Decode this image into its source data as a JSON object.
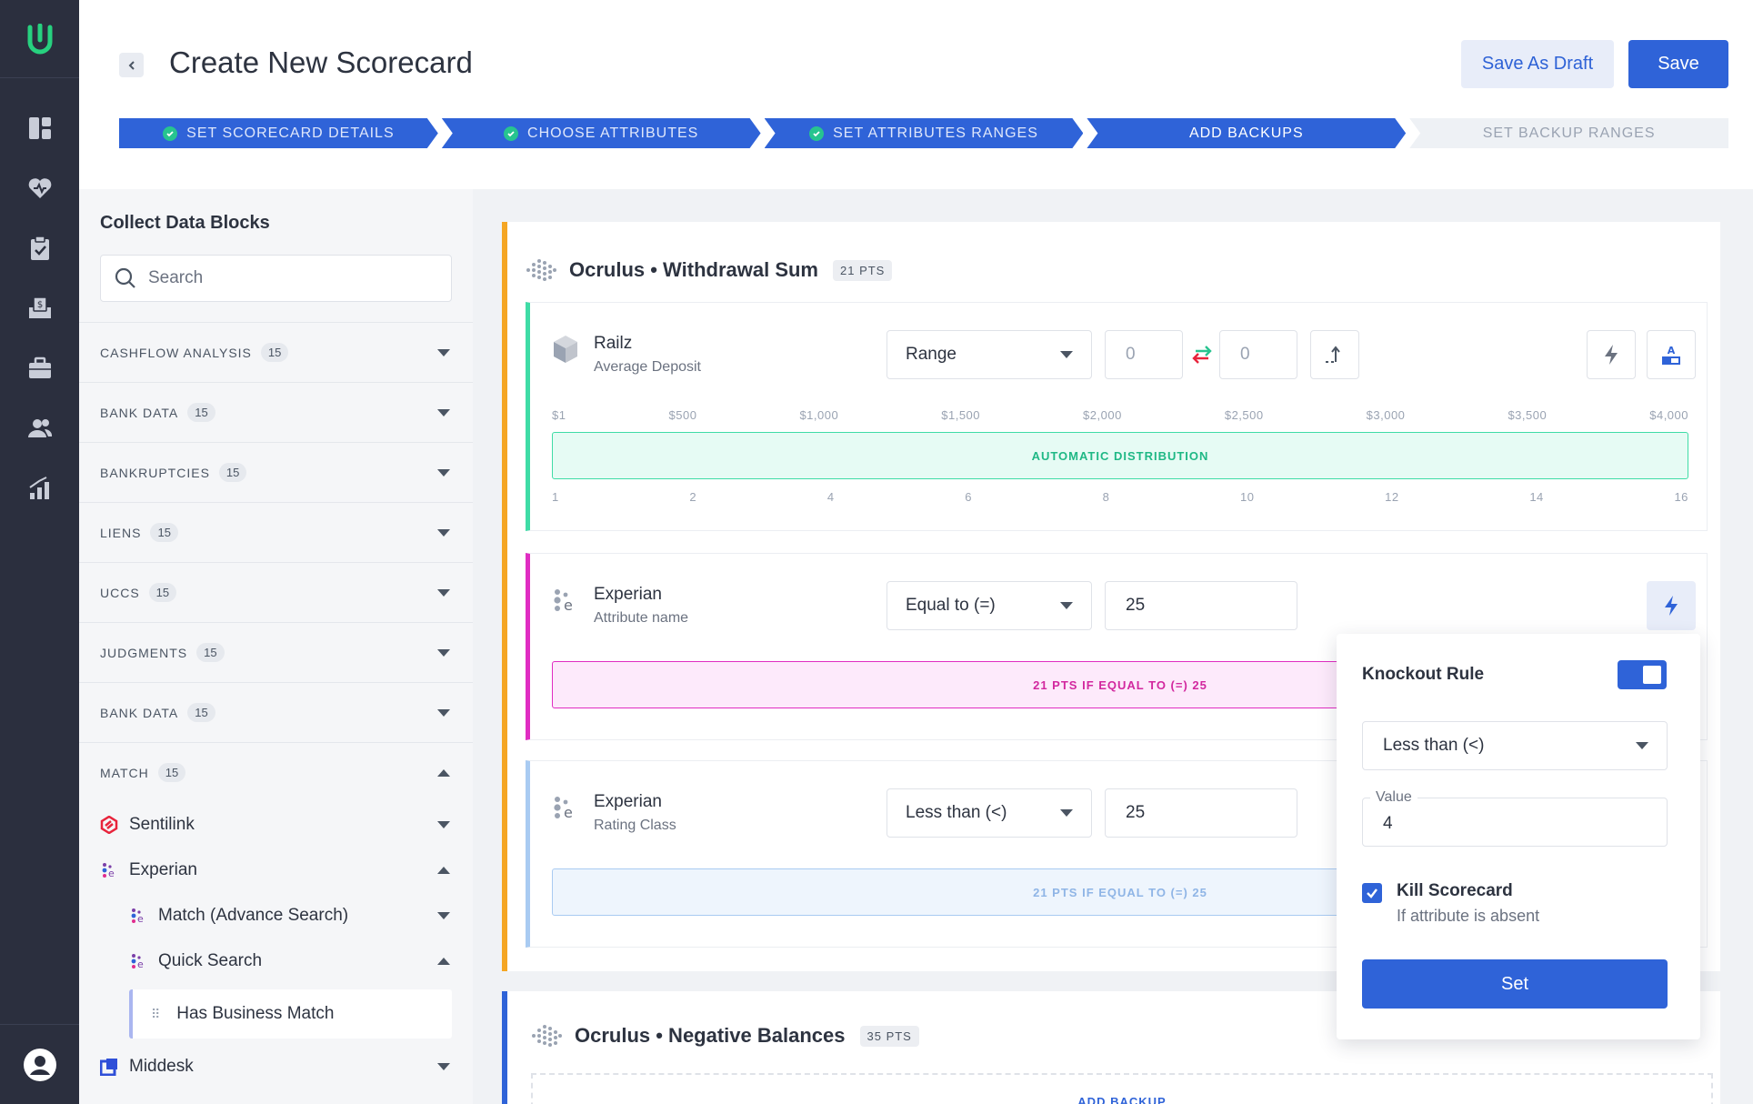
{
  "header": {
    "title": "Create New Scorecard",
    "save_draft_label": "Save As Draft",
    "save_label": "Save"
  },
  "steps": [
    {
      "label": "SET SCORECARD DETAILS",
      "state": "done"
    },
    {
      "label": "CHOOSE ATTRIBUTES",
      "state": "done"
    },
    {
      "label": "SET ATTRIBUTES RANGES",
      "state": "done"
    },
    {
      "label": "ADD BACKUPS",
      "state": "active"
    },
    {
      "label": "SET BACKUP RANGES",
      "state": "pending"
    }
  ],
  "sidebar": {
    "title": "Collect Data Blocks",
    "search_placeholder": "Search",
    "categories": [
      {
        "label": "CASHFLOW ANALYSIS",
        "count": "15"
      },
      {
        "label": "BANK DATA",
        "count": "15"
      },
      {
        "label": "BANKRUPTCIES",
        "count": "15"
      },
      {
        "label": "LIENS",
        "count": "15"
      },
      {
        "label": "UCCS",
        "count": "15"
      },
      {
        "label": "JUDGMENTS",
        "count": "15"
      },
      {
        "label": "BANK DATA",
        "count": "15"
      },
      {
        "label": "MATCH",
        "count": "15"
      }
    ],
    "providers": {
      "sentilink": "Sentilink",
      "experian": "Experian",
      "match_advance": "Match (Advance Search)",
      "quick_search": "Quick Search",
      "has_business_match": "Has Business Match",
      "middesk": "Middesk"
    }
  },
  "section1": {
    "name": "Ocrulus • Withdrawal Sum",
    "pts": "21 PTS",
    "card1": {
      "provider": "Railz",
      "attribute": "Average Deposit",
      "operator": "Range",
      "from": "0",
      "to": "0",
      "top_axis": [
        "$1",
        "$500",
        "$1,000",
        "$1,500",
        "$2,000",
        "$2,500",
        "$3,000",
        "$3,500",
        "$4,000"
      ],
      "bar": "AUTOMATIC DISTRIBUTION",
      "bottom_axis": [
        "1",
        "2",
        "4",
        "6",
        "8",
        "10",
        "12",
        "14",
        "16"
      ]
    },
    "card2": {
      "provider": "Experian",
      "attribute": "Attribute name",
      "operator": "Equal to (=)",
      "value": "25",
      "bar": "21 PTS IF EQUAL TO (=) 25"
    },
    "card3": {
      "provider": "Experian",
      "attribute": "Rating Class",
      "operator": "Less than (<)",
      "value": "25",
      "bar": "21 PTS IF EQUAL TO (=) 25"
    }
  },
  "section2": {
    "name": "Ocrulus • Negative Balances",
    "pts": "35 PTS",
    "add_backup": "ADD BACKUP"
  },
  "knockout": {
    "title": "Knockout Rule",
    "enabled": true,
    "operator": "Less than (<)",
    "value_label": "Value",
    "value": "4",
    "kill_label": "Kill Scorecard",
    "kill_sub": "If attribute is absent",
    "set_label": "Set"
  }
}
